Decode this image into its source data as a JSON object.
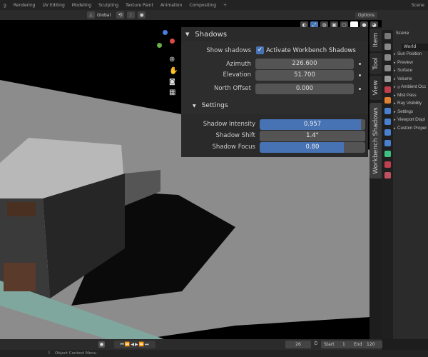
{
  "workspace_tabs": [
    "g",
    "Rendering",
    "UV Editing",
    "Modeling",
    "Sculpting",
    "Texture Paint",
    "Animation",
    "Compositing",
    "+"
  ],
  "header": {
    "orientation": "Global",
    "options": "Options"
  },
  "shadows_panel": {
    "title": "Shadows",
    "show_shadows_label": "Show shadows",
    "activate_label": "Activate Workbench Shadows",
    "activate_checked": true,
    "azimuth_label": "Azimuth",
    "azimuth": "226.600",
    "elevation_label": "Elevation",
    "elevation": "51.700",
    "north_offset_label": "North Offset",
    "north_offset": "0.000",
    "settings_title": "Settings",
    "intensity_label": "Shadow Intensity",
    "intensity": "0.957",
    "intensity_fraction": 0.957,
    "shift_label": "Shadow Shift",
    "shift": "1.4°",
    "shift_fraction": 0,
    "focus_label": "Shadow Focus",
    "focus": "0.80",
    "focus_fraction": 0.8
  },
  "sidebar_tabs": [
    "Item",
    "Tool",
    "View",
    "Workbench Shadows"
  ],
  "properties": {
    "scene": "Scene",
    "world": "World",
    "sections": [
      "Sun Position",
      "Preview",
      "Surface",
      "Volume",
      "Ambient Occ",
      "Mist Pass",
      "Ray Visibility",
      "Settings",
      "Viewport Displ",
      "Custom Proper"
    ]
  },
  "timeline": {
    "current_frame": "26",
    "start_label": "Start",
    "start": "1",
    "end_label": "End",
    "end": "120"
  },
  "status": {
    "hint": "Object Context Menu"
  },
  "colors": {
    "accent": "#4772b3",
    "panel": "#303030",
    "floor": "#8c8c8c"
  }
}
